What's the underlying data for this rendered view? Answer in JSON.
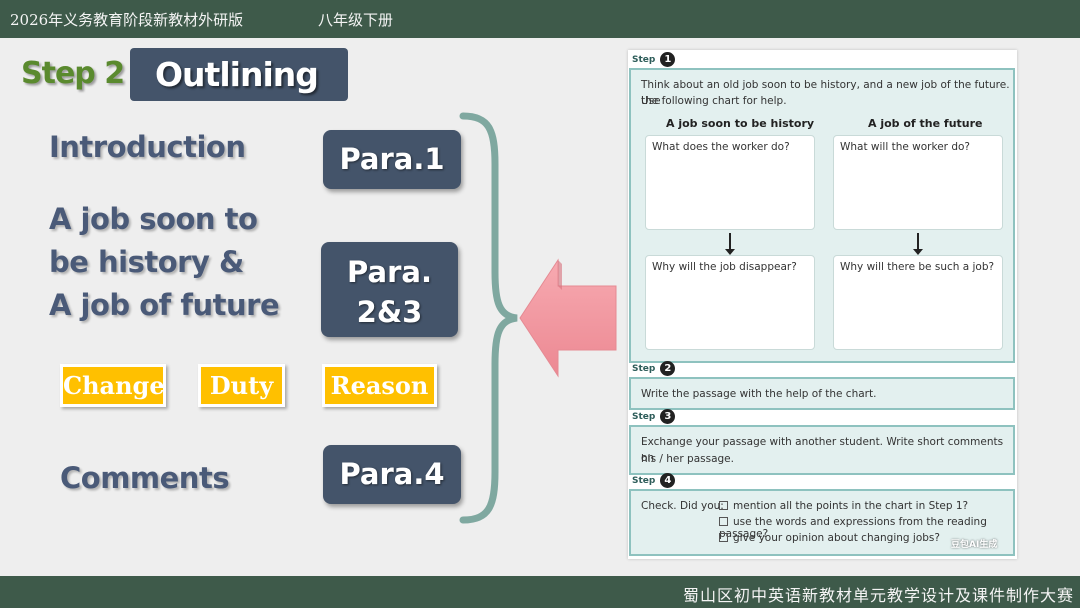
{
  "header": {
    "title": "2026年义务教育阶段新教材外研版",
    "grade": "八年级下册"
  },
  "footer": {
    "text": "蜀山区初中英语新教材单元教学设计及课件制作大赛"
  },
  "slide": {
    "step_label": "Step 2",
    "outline_title": "Outlining",
    "sections": {
      "intro": "Introduction",
      "jobs_line1": "A job soon to",
      "jobs_line2": "be history &",
      "jobs_line3": "A job of future",
      "comments": "Comments"
    },
    "paras": {
      "p1": "Para.1",
      "p23_line1": "Para.",
      "p23_line2": "2&3",
      "p4": "Para.4"
    },
    "tags": [
      "Change",
      "Duty",
      "Reason"
    ],
    "colors": {
      "dark_box": "#44546a",
      "tag": "#ffc000",
      "brace": "#7fa8a0",
      "arrow": "#f08f98",
      "bar": "#3e5a4a"
    }
  },
  "textbook": {
    "step_word": "Step",
    "step1": {
      "num": "1",
      "line1": "Think about an old job soon to be history, and a new job of the future. Use",
      "line2": "the following chart for help.",
      "col1_head": "A job soon to be history",
      "col2_head": "A job of the future",
      "q1": "What does the worker do?",
      "q2": "What will the worker do?",
      "q3": "Why will the job disappear?",
      "q4": "Why will there be such a job?"
    },
    "step2": {
      "num": "2",
      "text": "Write the passage with the help of the chart."
    },
    "step3": {
      "num": "3",
      "line1": "Exchange your passage with another student. Write short comments on",
      "line2": "his / her passage."
    },
    "step4": {
      "num": "4",
      "lead": "Check. Did you:",
      "items": [
        "mention all the points in the chart in Step 1?",
        "use the words and expressions from the reading passage?",
        "give your opinion about changing jobs?"
      ]
    },
    "watermark": "豆包AI生成"
  }
}
